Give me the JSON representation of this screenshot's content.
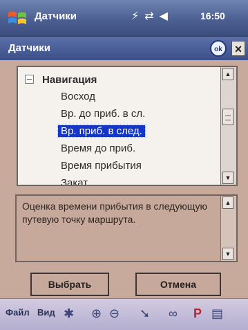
{
  "status_bar": {
    "app_title": "Датчики",
    "clock": "16:50",
    "icons": [
      "antenna-icon",
      "sync-icon",
      "speaker-icon"
    ]
  },
  "window": {
    "title": "Датчики",
    "ok_label": "ok",
    "close_label": "×"
  },
  "tree": {
    "root_label": "Навигация",
    "items": [
      {
        "label": "Восход",
        "selected": false
      },
      {
        "label": "Вр. до приб. в сл.",
        "selected": false
      },
      {
        "label": "Вр. приб. в след.",
        "selected": true
      },
      {
        "label": "Время до приб.",
        "selected": false
      },
      {
        "label": "Время прибытия",
        "selected": false
      },
      {
        "label": "Закат",
        "selected": false
      }
    ]
  },
  "description": {
    "text": "Оценка времени прибытия в следующую путевую точку маршрута."
  },
  "buttons": {
    "select_label": "Выбрать",
    "cancel_label": "Отмена"
  },
  "bottom_bar": {
    "file_label": "Файл",
    "view_label": "Вид",
    "icons": [
      "tools-icon",
      "zoom-in-icon",
      "zoom-out-icon",
      "locate-icon",
      "glasses-icon",
      "parking-icon",
      "keyboard-icon"
    ]
  },
  "colors": {
    "selection": "#1436c9",
    "titlebar": "#3c4f8a",
    "background": "#c8aa9c"
  }
}
